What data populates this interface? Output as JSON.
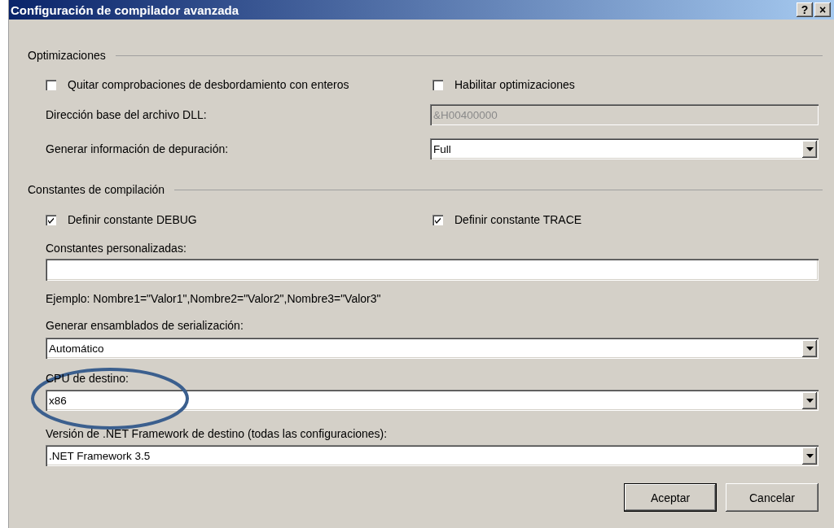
{
  "window": {
    "title": "Configuración de compilador avanzada",
    "buttons": [
      "?",
      "×"
    ]
  },
  "optimizations": {
    "heading": "Optimizaciones",
    "checks": [
      {
        "label": "Quitar comprobaciones de desbordamiento con enteros",
        "checked": false
      },
      {
        "label": "Habilitar optimizaciones",
        "checked": false
      }
    ],
    "dll_base_address": {
      "label": "Dirección base del archivo DLL:",
      "value": "&H00400000",
      "disabled": true
    },
    "debug_info": {
      "label": "Generar información de depuración:",
      "value": "Full"
    }
  },
  "constants": {
    "heading": "Constantes de compilación",
    "checks": [
      {
        "label": "Definir constante DEBUG",
        "checked": true
      },
      {
        "label": "Definir constante TRACE",
        "checked": true
      }
    ],
    "custom": {
      "label": "Constantes personalizadas:"
    },
    "example": "Ejemplo: Nombre1=\"Valor1\",Nombre2=\"Valor2\",Nombre3=\"Valor3\"",
    "serialization": {
      "label": "Generar ensamblados de serialización:",
      "value": "Automático"
    },
    "target_cpu": {
      "label": "CPU de destino:",
      "value": "x86"
    },
    "framework": {
      "label": "Versión de .NET Framework de destino (todas las configuraciones):",
      "value": ".NET Framework 3.5"
    }
  },
  "annotation": {
    "kind": "ellipse"
  },
  "buttons": [
    {
      "label": "Aceptar",
      "default": true
    },
    {
      "label": "Cancelar",
      "default": false
    }
  ]
}
